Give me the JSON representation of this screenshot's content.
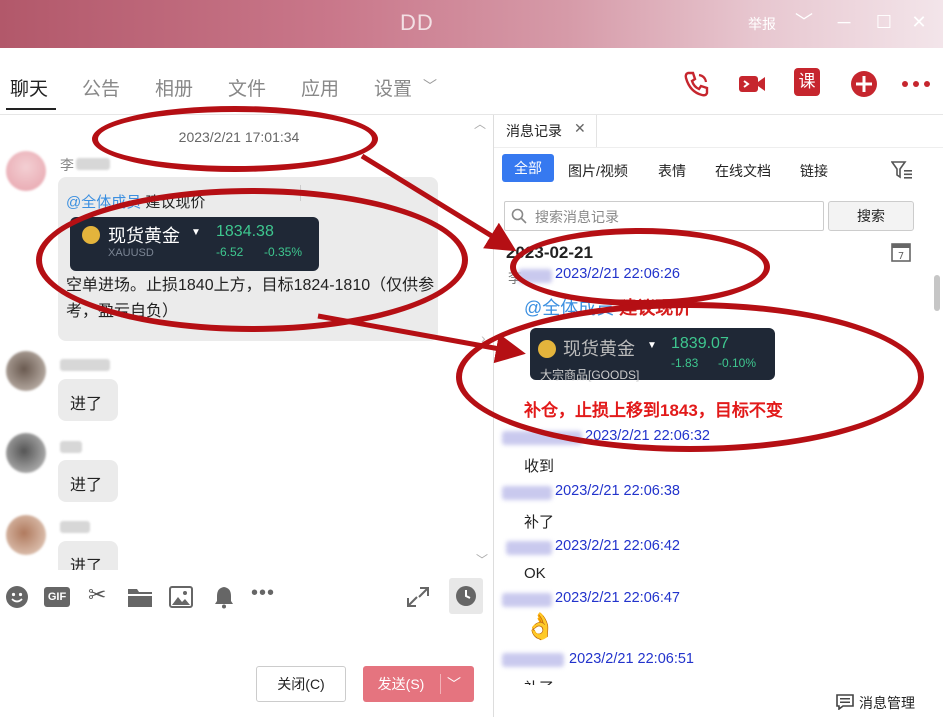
{
  "titlebar": {
    "title": "DD",
    "report": "举报",
    "minimize": "﹀",
    "restore": "─",
    "maximize": "☐",
    "close": "✕"
  },
  "tabs": [
    {
      "label": "聊天"
    },
    {
      "label": "公告"
    },
    {
      "label": "相册"
    },
    {
      "label": "文件"
    },
    {
      "label": "应用"
    },
    {
      "label": "设置"
    }
  ],
  "chat": {
    "timestamp": "2023/2/21 17:01:34",
    "sender1": "李",
    "mention": "@全体成员",
    "advice": "建议现价",
    "stock": {
      "name": "现货黄金",
      "price": "1834.38",
      "change": "-6.52",
      "pct": "-0.35%",
      "symbol": "XAUUSD"
    },
    "body": "空单进场。止损1840上方，目标1824-1810（仅供参考，盈亏自负）",
    "replies": [
      "进了",
      "进了",
      "进了"
    ]
  },
  "buttons": {
    "close": "关闭(C)",
    "send": "发送(S)"
  },
  "history": {
    "tab_label": "消息记录",
    "filters": [
      "全部",
      "图片/视频",
      "表情",
      "在线文档",
      "链接"
    ],
    "search_placeholder": "搜索消息记录",
    "search_button": "搜索",
    "date": "2023-02-21",
    "entries": [
      {
        "time": "2023/2/21 22:06:26",
        "sender": "李"
      },
      {
        "time": "2023/2/21 22:06:32",
        "text": "收到"
      },
      {
        "time": "2023/2/21 22:06:38",
        "text": "补了"
      },
      {
        "time": "2023/2/21 22:06:42",
        "text": "OK"
      },
      {
        "time": "2023/2/21 22:06:47",
        "text": "👌"
      },
      {
        "time": "2023/2/21 22:06:51",
        "text": "补了"
      }
    ],
    "mention": "@全体成员",
    "advice": "建议现价",
    "stock": {
      "name": "现货黄金",
      "price": "1839.07",
      "change": "-1.83",
      "pct": "-0.10%",
      "product": "大宗商品[GOODS]"
    },
    "update": "补仓，止损上移到1843，目标不变",
    "manage": "消息管理"
  },
  "colors": {
    "accent": "#3679f0",
    "danger": "#b50f14",
    "send": "#e5747f"
  }
}
